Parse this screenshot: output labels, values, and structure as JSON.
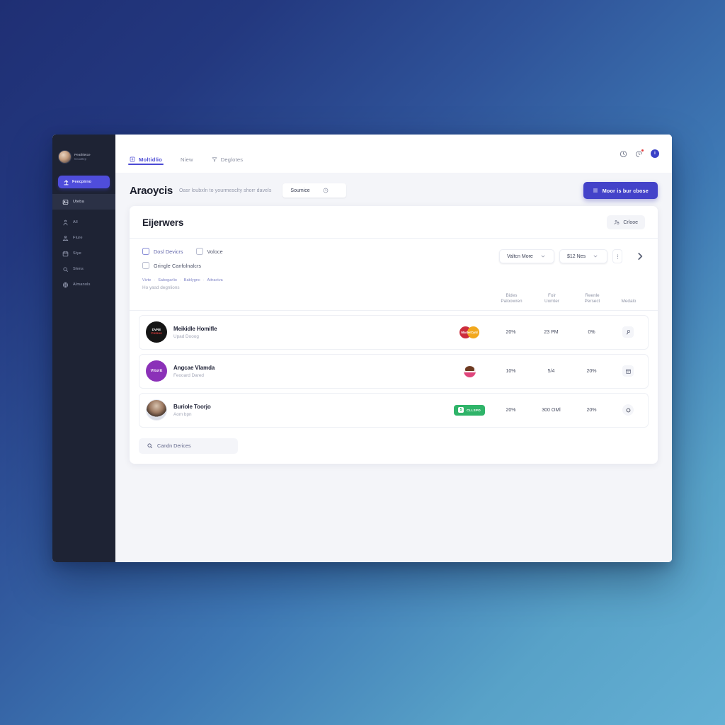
{
  "window": {
    "sidebar": {
      "profile": {
        "name": "Peathletce",
        "subtitle": "Incauttep",
        "avatar_icon": "user-photo-avatar"
      },
      "cta": {
        "label": "Feecpirno",
        "icon": "upload-icon"
      },
      "items": [
        {
          "label": "Uteba",
          "icon": "image-icon",
          "active": true
        },
        {
          "label": "All",
          "icon": "person-icon",
          "active": false
        },
        {
          "label": "Flure",
          "icon": "people-icon",
          "active": false
        },
        {
          "label": "Stye",
          "icon": "calendar-icon",
          "active": false
        },
        {
          "label": "Slens",
          "icon": "search-icon",
          "active": false
        },
        {
          "label": "Almanols",
          "icon": "globe-icon",
          "active": false
        }
      ]
    },
    "topbar": {
      "tabs": [
        {
          "label": "Moltidlio",
          "icon": "upload-box-icon",
          "active": true
        },
        {
          "label": "Niew",
          "icon": "",
          "active": false
        },
        {
          "label": "Deglotes",
          "icon": "filter-icon",
          "active": false
        }
      ],
      "actions": [
        {
          "name": "history-icon",
          "badge": false
        },
        {
          "name": "notification-icon",
          "badge": true
        },
        {
          "name": "user-avatar",
          "badge": false,
          "initial": "i"
        }
      ]
    },
    "page_header": {
      "title": "Araoycis",
      "subtitle": "Oasr loubxln to yourmesclty shorr davels",
      "source_pill": {
        "label": "Soumice",
        "icon": "clock-icon"
      },
      "primary_button": {
        "label": "Moor is bur cbose",
        "icon": "list-icon"
      }
    },
    "card": {
      "title": "Eijerwers",
      "close_button": {
        "label": "Crlooe",
        "icon": "user-lock-icon"
      },
      "filters": {
        "checkboxes": [
          {
            "label": "Dosl Devicrs",
            "accent": true,
            "checked": false
          },
          {
            "label": "Voloce",
            "accent": false,
            "checked": false
          },
          {
            "label": "Gringle Canfolnalcrs",
            "accent": false,
            "checked": false
          }
        ],
        "selects": [
          {
            "label": "Valtcn More",
            "width": "w1"
          },
          {
            "label": "$12 Nes",
            "width": "w2"
          }
        ],
        "kebab_icon": "more-vertical-icon",
        "next_icon": "chevron-right-icon"
      },
      "breadcrumbs": {
        "items": [
          "Vivte",
          "Sabogarlio",
          "Bablygnc",
          "Attractva"
        ],
        "separator": "·",
        "note": "Ho yasd degnlions"
      },
      "table": {
        "columns": [
          {
            "line1": "Bides",
            "line2": "Paloowren"
          },
          {
            "line1": "Foir",
            "line2": "Uomter"
          },
          {
            "line1": "Reenle",
            "line2": "Persect"
          },
          {
            "line1": "Medalo",
            "line2": ""
          }
        ],
        "rows": [
          {
            "avatar_style": "av-dark",
            "avatar_icon": "brand-dark-avatar",
            "avatar_mark_top": "DVRE",
            "avatar_mark_bottom": "Cemos",
            "name": "Meikidle Homifle",
            "sub": "Upad Dooog",
            "logo": {
              "type": "mastercard",
              "label": "MasterCard"
            },
            "cells": [
              "20%",
              "23 PM",
              "0%"
            ],
            "action_icon": "key-icon",
            "action_shape": "rounded"
          },
          {
            "avatar_style": "av-purple",
            "avatar_icon": "brand-purple-avatar",
            "avatar_mark_top": "Vitolit",
            "avatar_mark_bottom": "",
            "name": "Angcae Vlamda",
            "sub": "Feooard Dared",
            "logo": {
              "type": "cupcake",
              "label": ""
            },
            "cells": [
              "10%",
              "5/4",
              "20%"
            ],
            "action_icon": "calendar-small-icon",
            "action_shape": "rounded"
          },
          {
            "avatar_style": "av-photo",
            "avatar_icon": "user-photo-avatar",
            "avatar_mark_top": "",
            "avatar_mark_bottom": "",
            "name": "Buriole Toorjo",
            "sub": "Aom bpn",
            "logo": {
              "type": "green-badge",
              "label": "CLLSPO",
              "mark": "5"
            },
            "cells": [
              "20%",
              "300 OMl",
              "20%"
            ],
            "action_icon": "circle-icon",
            "action_shape": "circle"
          }
        ]
      },
      "footer_search": {
        "label": "Candn Derices",
        "icon": "search-icon"
      }
    }
  },
  "colors": {
    "accent": "#4342c9",
    "sidebar_bg": "#1e2334",
    "sidebar_cta": "#4f4ddb",
    "success": "#2fb469",
    "danger": "#e23b3b",
    "bg_gradient_from": "#1f2f74",
    "bg_gradient_to": "#64b0d4"
  }
}
